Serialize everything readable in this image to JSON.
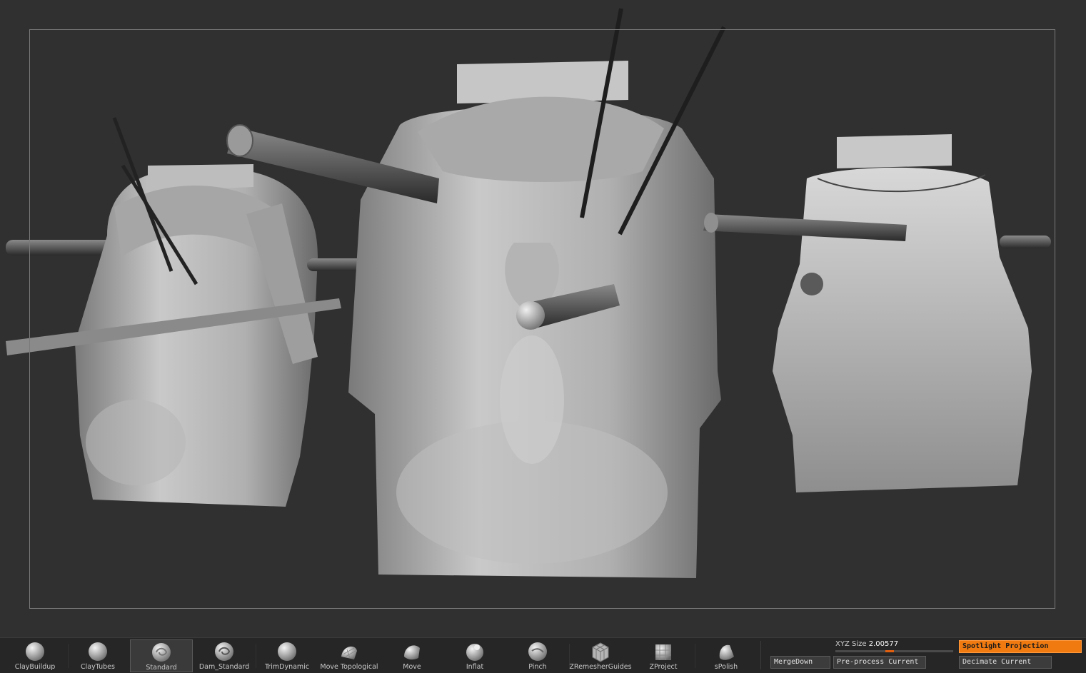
{
  "shelf": {
    "brushes": [
      {
        "label": "ClayBuildup",
        "icon": "claybuildup-brush-icon",
        "active": false
      },
      {
        "label": "ClayTubes",
        "icon": "claytubes-brush-icon",
        "active": false
      },
      {
        "label": "Standard",
        "icon": "standard-brush-icon",
        "active": true
      },
      {
        "label": "Dam_Standard",
        "icon": "dam-standard-brush-icon",
        "active": false
      },
      {
        "label": "TrimDynamic",
        "icon": "trimdynamic-brush-icon",
        "active": false
      },
      {
        "label": "Move Topological",
        "icon": "move-topological-brush-icon",
        "active": false
      },
      {
        "label": "Move",
        "icon": "move-brush-icon",
        "active": false
      },
      {
        "label": "Inflat",
        "icon": "inflat-brush-icon",
        "active": false
      },
      {
        "label": "Pinch",
        "icon": "pinch-brush-icon",
        "active": false
      },
      {
        "label": "ZRemesherGuides",
        "icon": "zremesherguides-brush-icon",
        "active": false
      },
      {
        "label": "ZProject",
        "icon": "zproject-brush-icon",
        "active": false
      },
      {
        "label": "sPolish",
        "icon": "spolish-brush-icon",
        "active": false
      }
    ],
    "xyz_size_label": "XYZ Size",
    "xyz_size_value": "2.00577",
    "buttons": {
      "merge_down": "MergeDown",
      "pre_process": "Pre-process Current",
      "spotlight": "Spotlight Projection",
      "decimate": "Decimate Current"
    }
  },
  "colors": {
    "accent": "#f07a10",
    "background": "#303030",
    "shelf": "#262626"
  }
}
